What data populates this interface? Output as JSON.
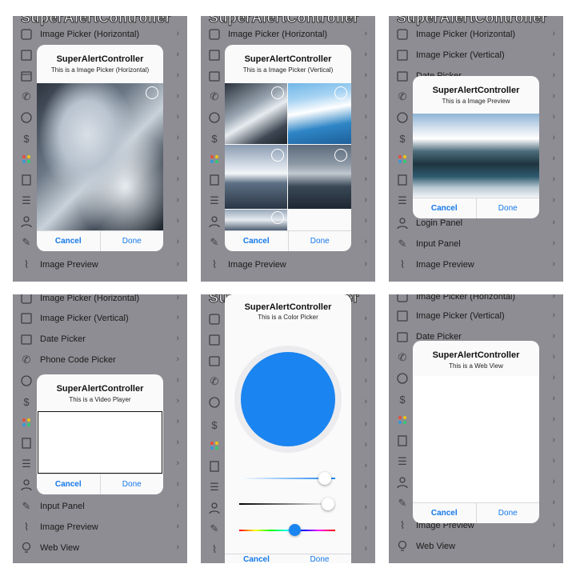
{
  "ghost_title": "SuperAlertController",
  "menu": {
    "image_picker_h": "Image Picker (Horizontal)",
    "image_picker_v": "Image Picker (Vertical)",
    "date_picker": "Date Picker",
    "phone_code_picker": "Phone Code Picker",
    "login_panel": "Login Panel",
    "input_panel": "Input Panel",
    "image_preview": "Image Preview",
    "web_view": "Web View",
    "chevron": "›"
  },
  "alerts": {
    "title": "SuperAlertController",
    "picker_h_msg": "This is a Image Picker (Horizontal)",
    "picker_v_msg": "This is a Image Picker (Vertical)",
    "preview_msg": "This is a Image Preview",
    "video_msg": "This is a Video Player",
    "color_msg": "This is a Color Picker",
    "web_msg": "This is a Web View",
    "cancel": "Cancel",
    "done": "Done"
  },
  "icons": [
    "square-icon",
    "film-icon",
    "calendar-icon",
    "phone-icon",
    "globe-icon",
    "dollar-icon",
    "color-palette-icon",
    "document-icon",
    "list-icon",
    "user-icon",
    "pencil-icon",
    "paperclip-icon",
    "lightbulb-icon"
  ],
  "colors": {
    "accent": "#1478ea",
    "color_picker_swatch": "#1a84f0",
    "dimmed_bg": "#8e8d93"
  }
}
